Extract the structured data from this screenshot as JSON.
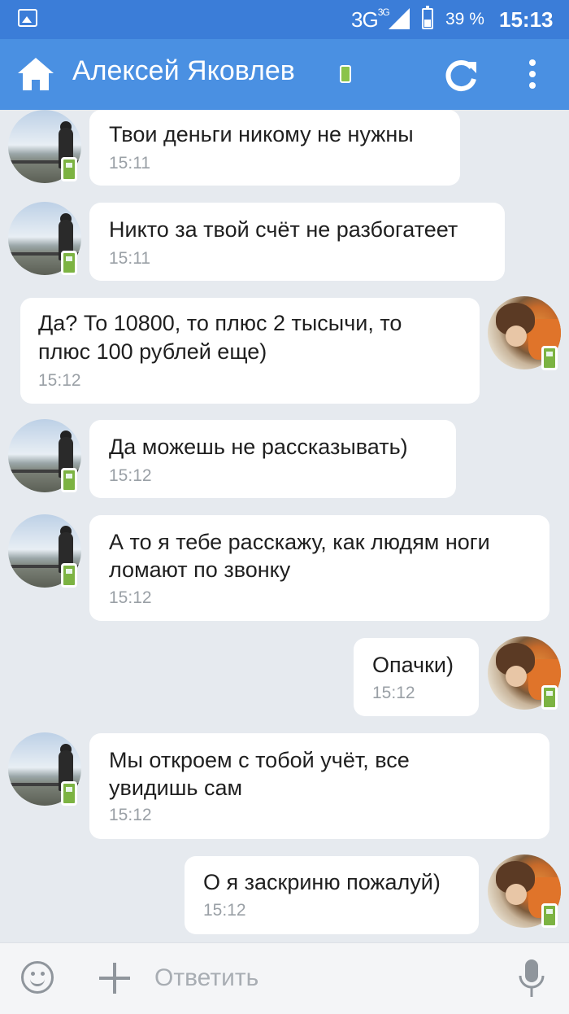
{
  "status_bar": {
    "network": "3G",
    "network_sup": "3G",
    "battery": "39 %",
    "time": "15:13"
  },
  "toolbar": {
    "title": "Алексей Яковлев"
  },
  "messages": [
    {
      "text": [
        "Твои деньги никому не нужны"
      ],
      "time": "15:11"
    },
    {
      "text": [
        "Никто за твой счёт не разбогатеет"
      ],
      "time": "15:11"
    },
    {
      "text": [
        "Да? То 10800, то плюс 2 тысычи, то",
        "плюс 100 рублей еще)"
      ],
      "time": "15:12"
    },
    {
      "text": [
        "Да можешь не рассказывать)"
      ],
      "time": "15:12"
    },
    {
      "text": [
        "А то я тебе расскажу, как людям ноги",
        "ломают по звонку"
      ],
      "time": "15:12"
    },
    {
      "text": [
        "Опачки)"
      ],
      "time": "15:12"
    },
    {
      "text": [
        "Мы откроем с тобой учёт, все",
        "увидишь сам"
      ],
      "time": "15:12"
    },
    {
      "text": [
        "О я заскриню пожалуй)"
      ],
      "time": "15:12"
    }
  ],
  "composer": {
    "placeholder": "Ответить"
  },
  "colors": {
    "status_bar": "#3b7dd8",
    "toolbar": "#4a90e2",
    "background": "#e6eaef",
    "online": "#7cb342"
  }
}
